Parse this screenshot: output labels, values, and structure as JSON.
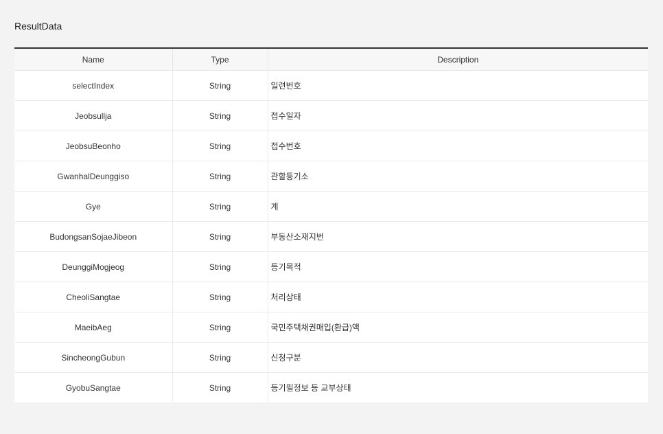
{
  "section_title": "ResultData",
  "table": {
    "headers": {
      "name": "Name",
      "type": "Type",
      "description": "Description"
    },
    "rows": [
      {
        "name": "selectIndex",
        "type": "String",
        "description": "일련번호"
      },
      {
        "name": "Jeobsullja",
        "type": "String",
        "description": "접수일자"
      },
      {
        "name": "JeobsuBeonho",
        "type": "String",
        "description": "접수번호"
      },
      {
        "name": "GwanhalDeunggiso",
        "type": "String",
        "description": "관할등기소"
      },
      {
        "name": "Gye",
        "type": "String",
        "description": "계"
      },
      {
        "name": "BudongsanSojaeJibeon",
        "type": "String",
        "description": "부동산소재지번"
      },
      {
        "name": "DeunggiMogjeog",
        "type": "String",
        "description": "등기목적"
      },
      {
        "name": "CheoliSangtae",
        "type": "String",
        "description": "처리상태"
      },
      {
        "name": "MaeibAeg",
        "type": "String",
        "description": "국민주택채권매입(환급)액"
      },
      {
        "name": "SincheongGubun",
        "type": "String",
        "description": "신청구분"
      },
      {
        "name": "GyobuSangtae",
        "type": "String",
        "description": "등기필정보 등 교부상태"
      }
    ]
  }
}
